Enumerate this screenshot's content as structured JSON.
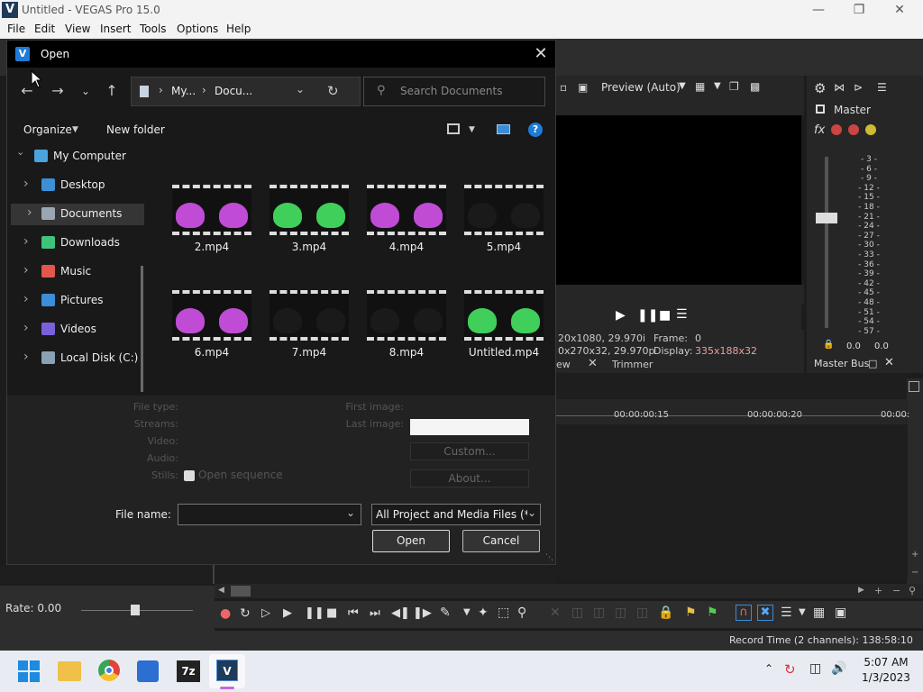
{
  "app": {
    "title": "Untitled - VEGAS Pro 15.0",
    "logo": "V",
    "menu": [
      "File",
      "Edit",
      "View",
      "Insert",
      "Tools",
      "Options",
      "Help"
    ]
  },
  "preview": {
    "mode": "Preview (Auto)",
    "info_line1": "20x1080, 29.970i",
    "info_line2": "0x270x32, 29.970p",
    "frame_label": "Frame:",
    "frame_value": "0",
    "display_label": "Display:",
    "display_value": "335x188x32",
    "tab_view": "ew",
    "tab_trimmer": "Trimmer"
  },
  "master": {
    "label": "Master",
    "scale": [
      "3",
      "6",
      "9",
      "12",
      "15",
      "18",
      "21",
      "24",
      "27",
      "30",
      "33",
      "36",
      "39",
      "42",
      "45",
      "48",
      "51",
      "54",
      "57"
    ],
    "left_value": "0.0",
    "right_value": "0.0",
    "bus_label": "Master Bus"
  },
  "timeline": {
    "ticks": [
      "00:00:00:15",
      "00:00:00:20",
      "00:00:"
    ]
  },
  "rate": "Rate: 0.00",
  "status": {
    "record_time": "Record Time (2 channels): 138:58:10"
  },
  "taskbar": {
    "time": "5:07 AM",
    "date": "1/3/2023"
  },
  "dialog": {
    "title": "Open",
    "logo": "V",
    "address": [
      "My...",
      "Docu..."
    ],
    "search_placeholder": "Search Documents",
    "organize": "Organize",
    "new_folder": "New folder",
    "nav_items": [
      {
        "label": "My Computer",
        "icon": "computer-icon",
        "color": "#4aa3df"
      },
      {
        "label": "Desktop",
        "icon": "desktop-icon",
        "color": "#3d8fd6"
      },
      {
        "label": "Documents",
        "icon": "documents-icon",
        "color": "#9aa7b3"
      },
      {
        "label": "Downloads",
        "icon": "downloads-icon",
        "color": "#3fc37a"
      },
      {
        "label": "Music",
        "icon": "music-icon",
        "color": "#e2574c"
      },
      {
        "label": "Pictures",
        "icon": "pictures-icon",
        "color": "#3b8fd9"
      },
      {
        "label": "Videos",
        "icon": "videos-icon",
        "color": "#7b61d9"
      },
      {
        "label": "Local Disk (C:)",
        "icon": "disk-icon",
        "color": "#8aa0b4"
      }
    ],
    "files": [
      {
        "name": "2.mp4",
        "color": "#c04cd6"
      },
      {
        "name": "3.mp4",
        "color": "#3fcf5a"
      },
      {
        "name": "4.mp4",
        "color": "#c04cd6"
      },
      {
        "name": "5.mp4",
        "color": "#1a1a1a"
      },
      {
        "name": "6.mp4",
        "color": "#c04cd6"
      },
      {
        "name": "7.mp4",
        "color": "#1a1a1a"
      },
      {
        "name": "8.mp4",
        "color": "#1a1a1a"
      },
      {
        "name": "Untitled.mp4",
        "color": "#3fcf5a"
      }
    ],
    "details": {
      "file_type": "File type:",
      "streams": "Streams:",
      "video": "Video:",
      "audio": "Audio:",
      "stills": "Stills:",
      "open_sequence": "Open sequence",
      "first_image": "First image:",
      "last_image": "Last image:",
      "custom": "Custom...",
      "about": "About..."
    },
    "file_name_label": "File name:",
    "file_name_value": "",
    "file_type_value": "All Project and Media Files (*.ve",
    "open_button": "Open",
    "cancel_button": "Cancel"
  }
}
